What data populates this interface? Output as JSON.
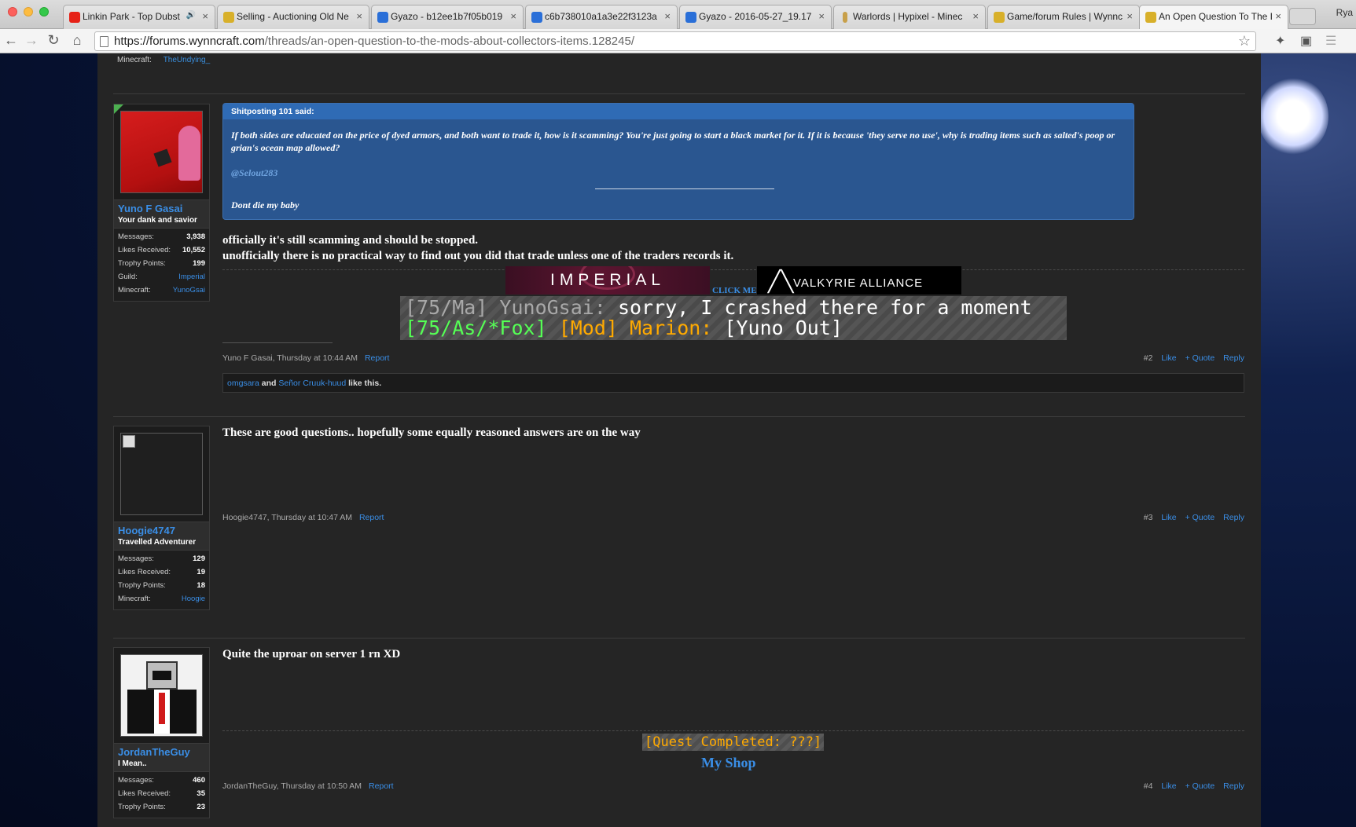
{
  "browser": {
    "tabs": [
      {
        "title": "Linkin Park - Top Dubst",
        "favicon_color": "#e62117",
        "has_audio": true
      },
      {
        "title": "Selling - Auctioning Old Ne",
        "favicon_color": "#d8b02a"
      },
      {
        "title": "Gyazo - b12ee1b7f05b019",
        "favicon_color": "#2a6fd8"
      },
      {
        "title": "c6b738010a1a3e22f3123a",
        "favicon_color": "#2a6fd8"
      },
      {
        "title": "Gyazo - 2016-05-27_19.17",
        "favicon_color": "#2a6fd8"
      },
      {
        "title": "Warlords | Hypixel - Minec",
        "favicon_color": "#c8a04a"
      },
      {
        "title": "Game/forum Rules | Wynnc",
        "favicon_color": "#d8b02a"
      },
      {
        "title": "An Open Question To The I",
        "favicon_color": "#d8b02a",
        "active": true
      }
    ],
    "profile_name": "Rya",
    "url_host": "https://forums.wynncraft.com",
    "url_path": "/threads/an-open-question-to-the-mods-about-collectors-items.128245/"
  },
  "prev_post": {
    "minecraft_label": "Minecraft:",
    "minecraft_value": "TheUndying_"
  },
  "posts": [
    {
      "author": "Yuno F Gasai",
      "user_title": "Your dank and savior",
      "stats": [
        {
          "label": "Messages:",
          "value": "3,938"
        },
        {
          "label": "Likes Received:",
          "value": "10,552"
        },
        {
          "label": "Trophy Points:",
          "value": "199"
        },
        {
          "label": "Guild:",
          "value": "Imperial"
        },
        {
          "label": "Minecraft:",
          "value": "YunoGsai"
        }
      ],
      "quote": {
        "header": "Shitposting 101 said:",
        "text": "If both sides are educated on the price of dyed armors, and both want to trade it, how is it scamming? You're just going to start a black market for it. If it is because 'they serve no use', why is trading items such as salted's poop or grian's ocean map allowed?",
        "mention": "@Selout283",
        "signoff": "Dont die my baby"
      },
      "body_line1": "officially it's still scamming and should be stopped.",
      "body_line2": "unofficially there is no practical way to find out you did that trade unless one of the traders records it.",
      "signature": {
        "banner_left": "IMPERIAL",
        "click_me": "CLICK ME",
        "banner_right": "VALKYRIE ALLIANCE",
        "chat_line1_prefix": "[75/Ma] YunoGsai:",
        "chat_line1_msg": "sorry, I crashed there for a moment",
        "chat_line2_prefix": "[75/As/*Fox]",
        "chat_line2_rank": "[Mod] Marion:",
        "chat_line2_msg": "[Yuno Out]"
      },
      "meta_author": "Yuno F Gasai,",
      "meta_time": "Thursday at 10:44 AM",
      "report": "Report",
      "number": "#2",
      "like": "Like",
      "quote_btn": "+ Quote",
      "reply": "Reply",
      "likes_user1": "omgsara",
      "likes_and": "and",
      "likes_user2": "Señor Cruuk-huud",
      "likes_suffix": "like this."
    },
    {
      "author": "Hoogie4747",
      "user_title": "Travelled Adventurer",
      "stats": [
        {
          "label": "Messages:",
          "value": "129"
        },
        {
          "label": "Likes Received:",
          "value": "19"
        },
        {
          "label": "Trophy Points:",
          "value": "18"
        },
        {
          "label": "Minecraft:",
          "value": "Hoogie"
        }
      ],
      "body": "These are good questions.. hopefully some equally reasoned answers are on the way",
      "meta_author": "Hoogie4747,",
      "meta_time": "Thursday at 10:47 AM",
      "report": "Report",
      "number": "#3",
      "like": "Like",
      "quote_btn": "+ Quote",
      "reply": "Reply"
    },
    {
      "author": "JordanTheGuy",
      "user_title": "I Mean..",
      "stats": [
        {
          "label": "Messages:",
          "value": "460"
        },
        {
          "label": "Likes Received:",
          "value": "35"
        },
        {
          "label": "Trophy Points:",
          "value": "23"
        }
      ],
      "body": "Quite the uproar on server 1 rn XD",
      "signature": {
        "quest": "[Quest Completed: ???]",
        "shop": "My Shop"
      },
      "meta_author": "JordanTheGuy,",
      "meta_time": "Thursday at 10:50 AM",
      "report": "Report",
      "number": "#4",
      "like": "Like",
      "quote_btn": "+ Quote",
      "reply": "Reply"
    }
  ]
}
